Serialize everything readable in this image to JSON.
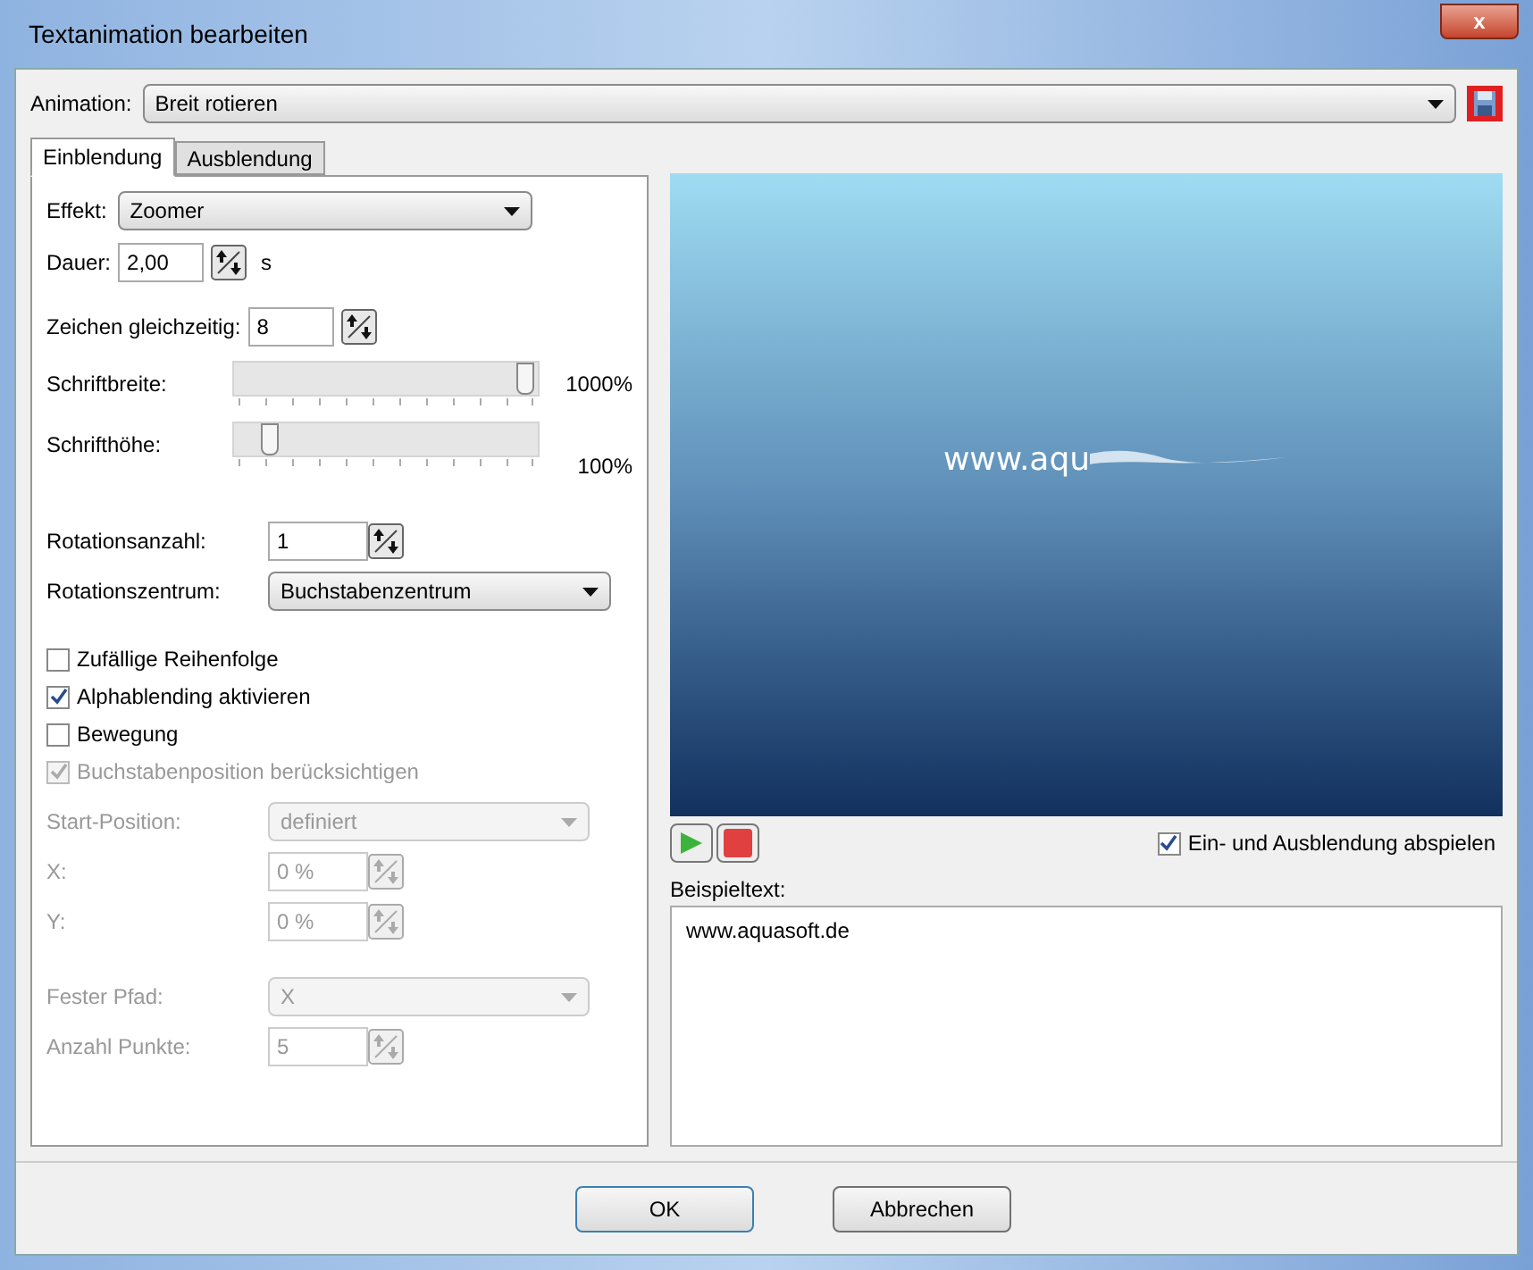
{
  "window": {
    "title": "Textanimation bearbeiten",
    "close": "x"
  },
  "animation": {
    "label": "Animation:",
    "value": "Breit rotieren"
  },
  "tabs": [
    {
      "label": "Einblendung",
      "selected": true
    },
    {
      "label": "Ausblendung",
      "selected": false
    }
  ],
  "effekt": {
    "label": "Effekt:",
    "value": "Zoomer"
  },
  "dauer": {
    "label": "Dauer:",
    "value": "2,00",
    "unit": "s"
  },
  "zeichen": {
    "label": "Zeichen gleichzeitig:",
    "value": "8"
  },
  "sliders": [
    {
      "label": "Schriftbreite:",
      "level": 1.0,
      "reading": "1000%"
    },
    {
      "label": "Schrifthöhe:",
      "level": 0.1,
      "reading": "100%"
    }
  ],
  "rotationsanzahl": {
    "label": "Rotationsanzahl:",
    "value": "1"
  },
  "rotationszentrum": {
    "label": "Rotationszentrum:",
    "value": "Buchstabenzentrum"
  },
  "checkboxes": [
    {
      "label": "Zufällige Reihenfolge",
      "checked": false,
      "disabled": false
    },
    {
      "label": "Alphablending aktivieren",
      "checked": true,
      "disabled": false
    },
    {
      "label": "Bewegung",
      "checked": false,
      "disabled": false
    },
    {
      "label": "Buchstabenposition berücksichtigen",
      "checked": true,
      "disabled": true
    }
  ],
  "fields": [
    {
      "kind": "select",
      "label": "Start-Position:",
      "value": "definiert",
      "disabled": true
    },
    {
      "kind": "spin",
      "label": "X:",
      "value": "0 %",
      "disabled": true
    },
    {
      "kind": "spin",
      "label": "Y:",
      "value": "0 %",
      "disabled": true
    },
    {
      "kind": "gap"
    },
    {
      "kind": "select",
      "label": "Fester Pfad:",
      "value": "X",
      "disabled": true
    },
    {
      "kind": "spin",
      "label": "Anzahl Punkte:",
      "value": "5",
      "disabled": true
    }
  ],
  "preview": {
    "text": "www.aqu"
  },
  "play_both": {
    "label": "Ein- und Ausblendung abspielen",
    "checked": true
  },
  "beispieltext": {
    "label": "Beispieltext:",
    "value": "www.aquasoft.de"
  },
  "buttons": [
    "OK",
    "Abbrechen"
  ]
}
